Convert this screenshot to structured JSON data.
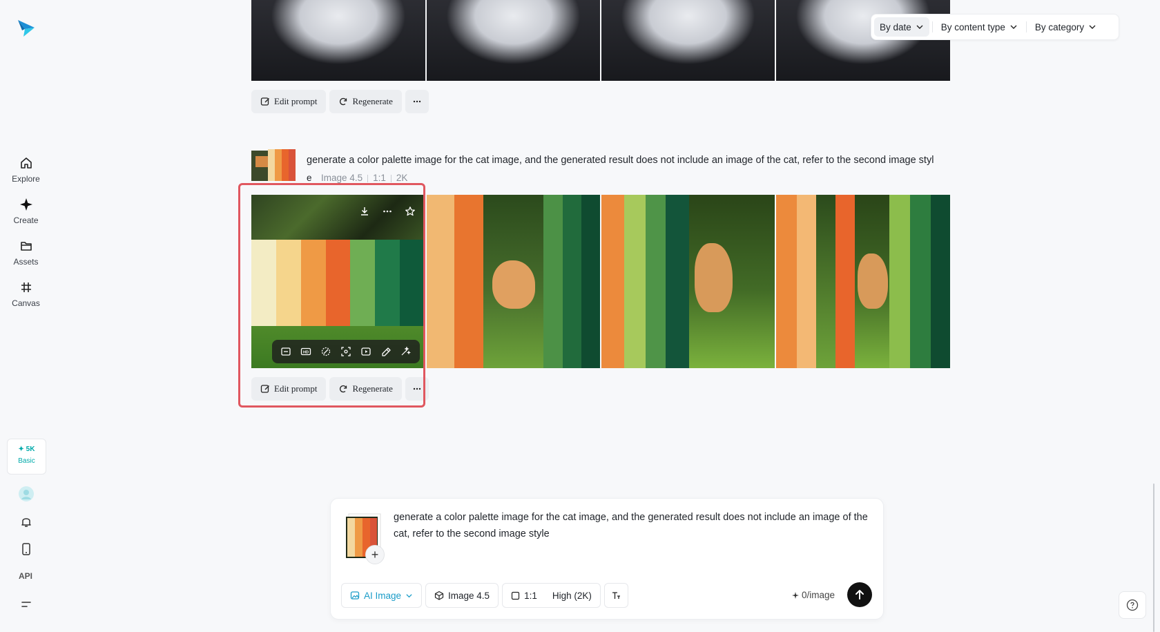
{
  "sidebar": {
    "items": [
      {
        "label": "Explore",
        "icon": "home-icon"
      },
      {
        "label": "Create",
        "icon": "sparkle-icon"
      },
      {
        "label": "Assets",
        "icon": "folder-icon"
      },
      {
        "label": "Canvas",
        "icon": "canvas-icon"
      }
    ],
    "credits": {
      "amount": "✦ 5K",
      "plan": "Basic"
    },
    "api_label": "API"
  },
  "filters": {
    "by_date": "By date",
    "by_content_type": "By content type",
    "by_category": "By category"
  },
  "generation_top": {
    "edit_prompt": "Edit prompt",
    "regenerate": "Regenerate"
  },
  "generation": {
    "prompt_line1": "generate a color palette image for the cat image, and the generated result does not include an image of the cat, refer to the second image styl",
    "prompt_line2_start": "e",
    "model": "Image 4.5",
    "ratio": "1:1",
    "resolution": "2K",
    "edit_prompt": "Edit prompt",
    "regenerate": "Regenerate"
  },
  "composer": {
    "prompt": "generate a color palette image for the cat image, and the generated result does not include an image of the cat, refer to the second image style",
    "mode": "AI Image",
    "model": "Image 4.5",
    "ratio": "1:1",
    "quality": "High (2K)",
    "cost": "0/image"
  },
  "colors": {
    "accent": "#1a9cc8",
    "highlight": "#e0575f",
    "palette": [
      "#f3ecc4",
      "#f5d58c",
      "#ef9a45",
      "#e8652c",
      "#6fae54",
      "#207a49",
      "#0f5a3a"
    ]
  }
}
